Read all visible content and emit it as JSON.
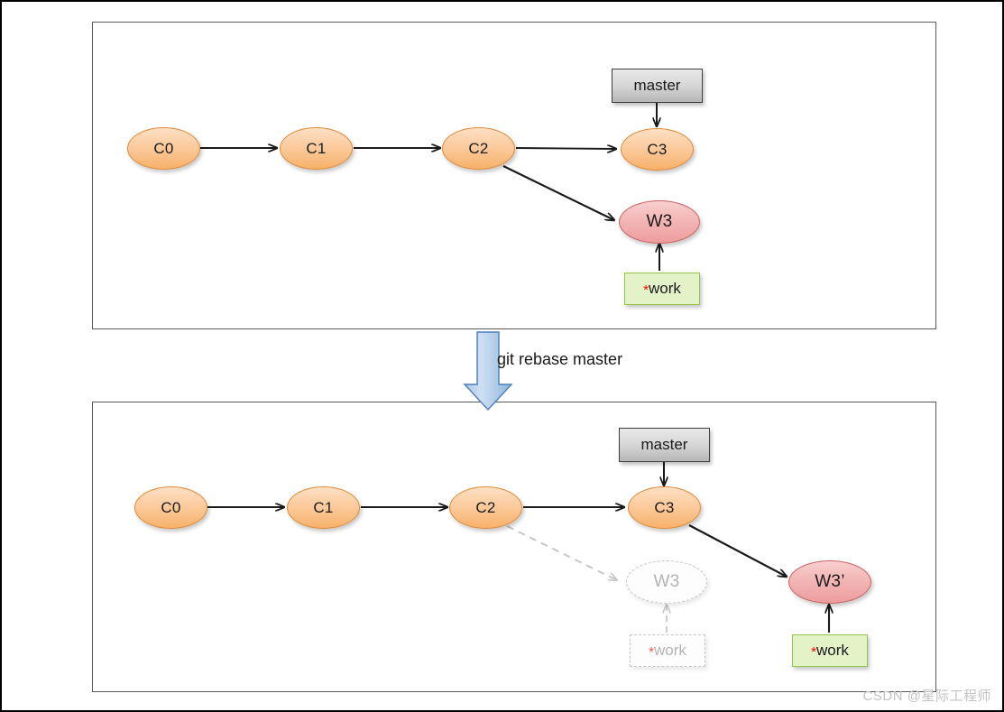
{
  "diagram": {
    "title": "git rebase master",
    "transition_label": "git rebase master",
    "watermark": "CSDN @星际工程师",
    "colors": {
      "commit_fill": "#fbcb9e",
      "commit_stroke": "#e08a36",
      "work_fill": "#f3b6b6",
      "work_stroke": "#cc5f5f",
      "branch_fill": "#d6d6d6",
      "branch_stroke": "#3f3f3f",
      "tag_fill": "#e3f2c7",
      "tag_stroke": "#93c34b",
      "ghost": "#b4b4b4",
      "asterisk": "#ff0000",
      "arrow": "#1a1a1a",
      "transition_arrow": "#8eb4e3",
      "panel_border": "#595959"
    }
  },
  "panel_before": {
    "name": "before-rebase",
    "nodes": {
      "c0": "C0",
      "c1": "C1",
      "c2": "C2",
      "c3": "C3",
      "w3": "W3"
    },
    "labels": {
      "master": "master",
      "work_star": "*",
      "work_text": "work"
    }
  },
  "panel_after": {
    "name": "after-rebase",
    "nodes": {
      "c0": "C0",
      "c1": "C1",
      "c2": "C2",
      "c3": "C3",
      "w3_ghost": "W3",
      "w3_prime": "W3’"
    },
    "labels": {
      "master": "master",
      "work_star": "*",
      "work_text": "work",
      "work_star_ghost": "*",
      "work_text_ghost": "work"
    }
  }
}
